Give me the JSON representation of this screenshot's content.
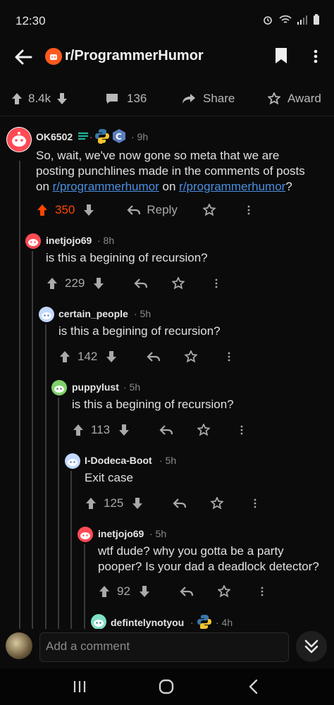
{
  "status": {
    "time": "12:30"
  },
  "header": {
    "subreddit": "r/ProgrammerHumor"
  },
  "actions": {
    "upvotes": "8.4k",
    "comments": "136",
    "share": "Share",
    "award": "Award"
  },
  "comments": [
    {
      "user": "OK6502",
      "time": "· 9h",
      "text_a": "So, wait, we've now gone so meta that we are",
      "text_b": "posting punchlines made in the comments of posts",
      "text_c_on": "on ",
      "link1": "r/programmerhumor",
      "text_c_mid": " on ",
      "link2": "r/programmerhumor",
      "text_c_end": "?",
      "score": "350",
      "reply": "Reply"
    },
    {
      "user": "inetjojo69",
      "time": "· 8h",
      "text": "is this a begining of recursion?",
      "score": "229"
    },
    {
      "user": "certain_people",
      "time": "· 5h",
      "text": "is this a begining of recursion?",
      "score": "142"
    },
    {
      "user": "puppylust",
      "time": "· 5h",
      "text": "is this a begining of recursion?",
      "score": "113"
    },
    {
      "user": "I-Dodeca-Boot",
      "time": "· 5h",
      "text": "Exit case",
      "score": "125"
    },
    {
      "user": "inetjojo69",
      "time": "· 5h",
      "text_a": "wtf dude? why you gotta be a party",
      "text_b": "pooper? Is your dad a deadlock detector?",
      "score": "92"
    },
    {
      "user": "defintelynotyou",
      "time": "· 4h"
    }
  ],
  "composer": {
    "placeholder": "Add a comment"
  },
  "colors": {
    "upvoted": "#ff4500",
    "link": "#4a90e2",
    "background": "#0b0b0b"
  }
}
